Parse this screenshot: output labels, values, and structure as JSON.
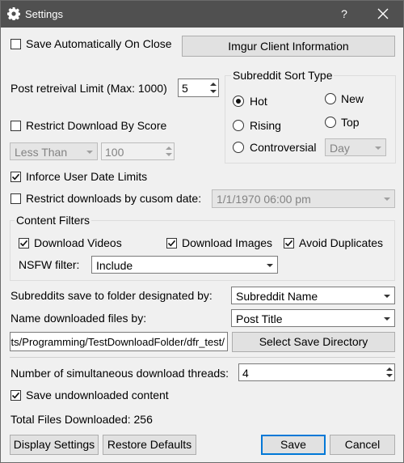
{
  "window": {
    "title": "Settings",
    "help": "?"
  },
  "save_auto": {
    "label": "Save Automatically On Close",
    "checked": false
  },
  "imgur_button": "Imgur Client Information",
  "post_limit": {
    "label": "Post retreival Limit (Max: 1000)",
    "value": "5"
  },
  "restrict_score": {
    "label": "Restrict Download By Score",
    "checked": false,
    "comparator": "Less Than",
    "value": "100"
  },
  "sort": {
    "title": "Subreddit Sort Type",
    "options": [
      "Hot",
      "New",
      "Rising",
      "Top",
      "Controversial"
    ],
    "selected": "Hot",
    "period": "Day"
  },
  "user_date_limits": {
    "label": "Inforce User Date Limits",
    "checked": true
  },
  "custom_date": {
    "label": "Restrict downloads by cusom date:",
    "checked": false,
    "value": "1/1/1970 06:00 pm"
  },
  "content_filters": {
    "title": "Content Filters",
    "download_videos": {
      "label": "Download Videos",
      "checked": true
    },
    "download_images": {
      "label": "Download Images",
      "checked": true
    },
    "avoid_duplicates": {
      "label": "Avoid Duplicates",
      "checked": true
    },
    "nsfw_label": "NSFW filter:",
    "nsfw_value": "Include"
  },
  "folder_by": {
    "label": "Subreddits save to folder designated by:",
    "value": "Subreddit Name"
  },
  "name_by": {
    "label": "Name downloaded files by:",
    "value": "Post Title"
  },
  "save_path": "its/Programming/TestDownloadFolder/dfr_test/",
  "select_dir_button": "Select Save Directory",
  "threads": {
    "label": "Number of simultaneous download threads:",
    "value": "4"
  },
  "save_undownloaded": {
    "label": "Save undownloaded content",
    "checked": true
  },
  "total": "Total Files Downloaded: 256",
  "buttons": {
    "display_settings": "Display Settings",
    "restore_defaults": "Restore Defaults",
    "save": "Save",
    "cancel": "Cancel"
  },
  "colors": {
    "titlebar": "#505050",
    "background": "#f0f0f0",
    "accent": "#0078d7"
  }
}
